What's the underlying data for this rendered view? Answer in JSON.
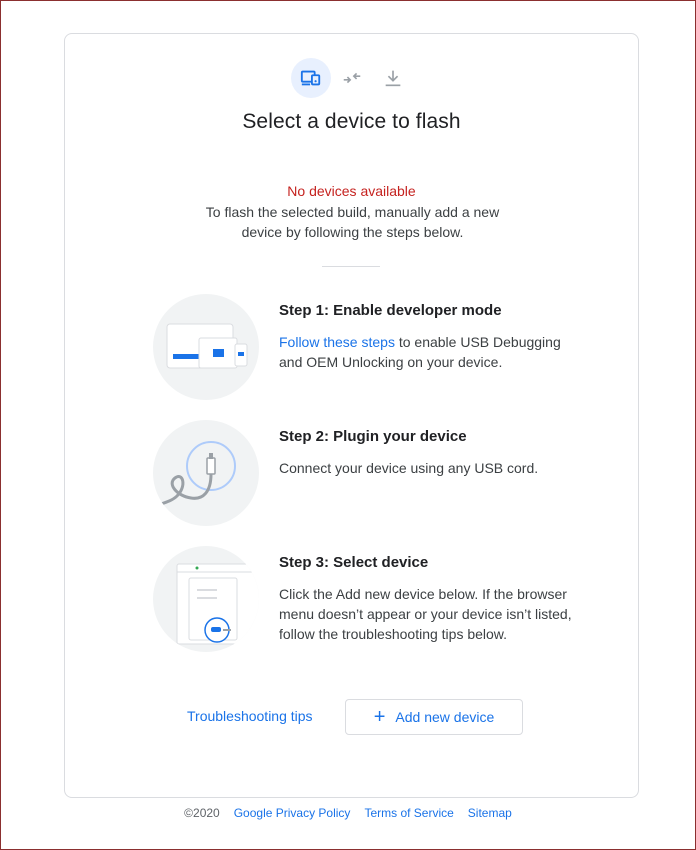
{
  "stepper": {
    "steps": [
      {
        "icon": "devices-icon",
        "active": true
      },
      {
        "icon": "connect-arrows-icon",
        "active": false
      },
      {
        "icon": "download-icon",
        "active": false
      }
    ]
  },
  "main": {
    "title": "Select a device to flash",
    "status": "No devices available",
    "description": "To flash the selected build, manually add a new device by following the steps below."
  },
  "steps": [
    {
      "title": "Step 1: Enable developer mode",
      "link_text": "Follow these steps",
      "text": " to enable USB Debugging and OEM Unlocking on your device.",
      "illustration": "devices-illustration"
    },
    {
      "title": "Step 2: Plugin your device",
      "text": "Connect your device using any USB cord.",
      "illustration": "usb-cable-illustration"
    },
    {
      "title": "Step 3: Select device",
      "text": "Click the Add new device below. If the browser menu doesn’t appear or your device isn’t listed, follow the troubleshooting tips below.",
      "illustration": "browser-menu-illustration"
    }
  ],
  "actions": {
    "troubleshooting_label": "Troubleshooting tips",
    "add_device_label": "Add new device"
  },
  "footer": {
    "copyright": "©2020",
    "links": [
      "Google Privacy Policy",
      "Terms of Service",
      "Sitemap"
    ]
  },
  "colors": {
    "accent": "#1a73e8",
    "error": "#c5221f",
    "illustration_bg": "#f1f3f4"
  }
}
